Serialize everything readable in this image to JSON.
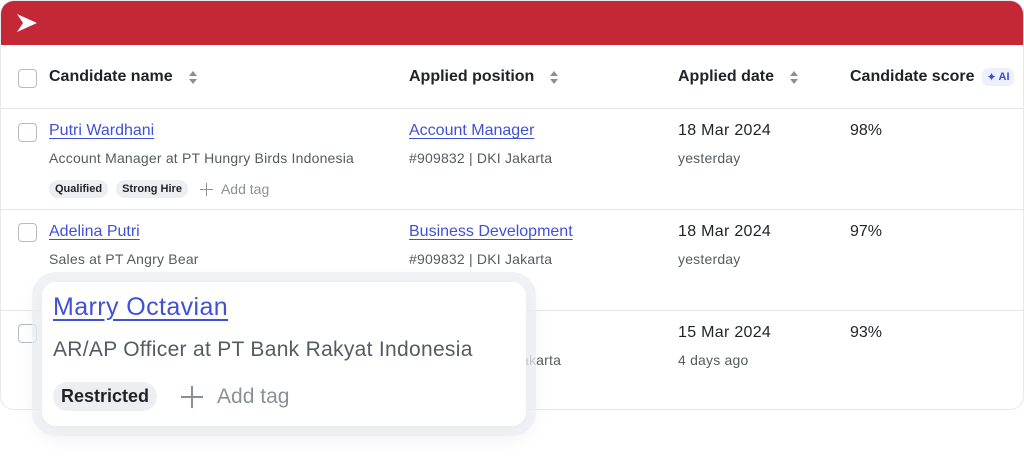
{
  "colors": {
    "brand": "#c42736",
    "link": "#4051d6",
    "ai": "#3b4bd8"
  },
  "header": {
    "logo_icon": "play-chevron-icon"
  },
  "table": {
    "columns": {
      "candidate_name": "Candidate name",
      "applied_position": "Applied position",
      "applied_date": "Applied date",
      "candidate_score": "Candidate score",
      "ai_badge": "AI"
    },
    "rows": [
      {
        "name": "Putri Wardhani",
        "title": "Account Manager at PT Hungry Birds Indonesia",
        "position": "Account Manager",
        "position_meta": "#909832 | DKI Jakarta",
        "date": "18 Mar 2024",
        "date_relative": "yesterday",
        "score": "98%",
        "tags": [
          "Qualified",
          "Strong Hire"
        ],
        "add_tag": "Add tag"
      },
      {
        "name": "Adelina Putri",
        "title": "Sales at PT Angry Bear",
        "position": "Business Development",
        "position_meta": "#909832 | DKI Jakarta",
        "date": "18 Mar 2024",
        "date_relative": "yesterday",
        "score": "97%"
      },
      {
        "position_meta_partial": "akarta",
        "date": "15 Mar 2024",
        "date_relative": "4 days ago",
        "score": "93%"
      }
    ]
  },
  "popup": {
    "name": "Marry Octavian",
    "title": "AR/AP Officer at PT Bank Rakyat Indonesia",
    "tag": "Restricted",
    "add_tag": "Add tag"
  }
}
